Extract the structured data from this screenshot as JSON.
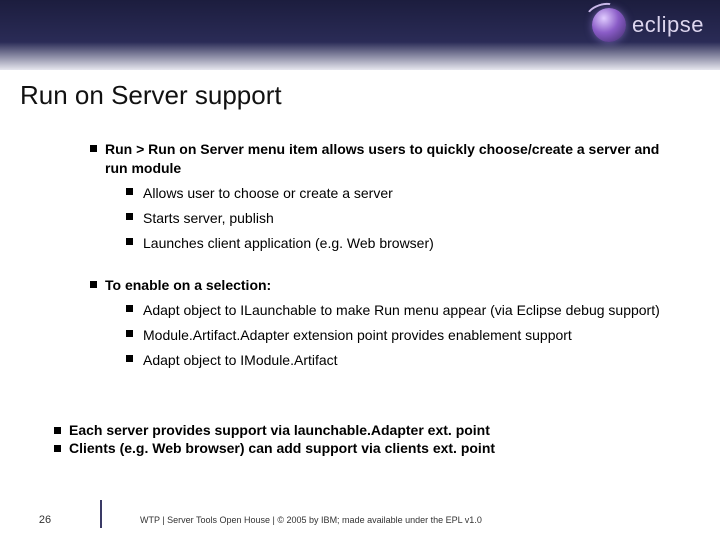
{
  "logo": {
    "text": "eclipse"
  },
  "title": "Run on Server support",
  "bullets": {
    "b1": "Run > Run on Server menu item allows users to quickly choose/create a server and run module",
    "b1_sub": {
      "a": "Allows user to choose or create a server",
      "b": "Starts server, publish",
      "c": "Launches client application (e.g. Web browser)"
    },
    "b2": "To enable on a selection:",
    "b2_sub": {
      "a": "Adapt object to ILaunchable to make Run menu appear (via Eclipse debug support)",
      "b": "Module.Artifact.Adapter extension point provides enablement support",
      "c": "Adapt object to IModule.Artifact"
    },
    "b3": "Each server provides support via launchable.Adapter ext. point",
    "b4": "Clients (e.g. Web browser) can add support via clients ext. point"
  },
  "footer": {
    "page": "26",
    "text": "WTP  |  Server Tools Open House  |  © 2005 by IBM; made available under the EPL v1.0"
  }
}
